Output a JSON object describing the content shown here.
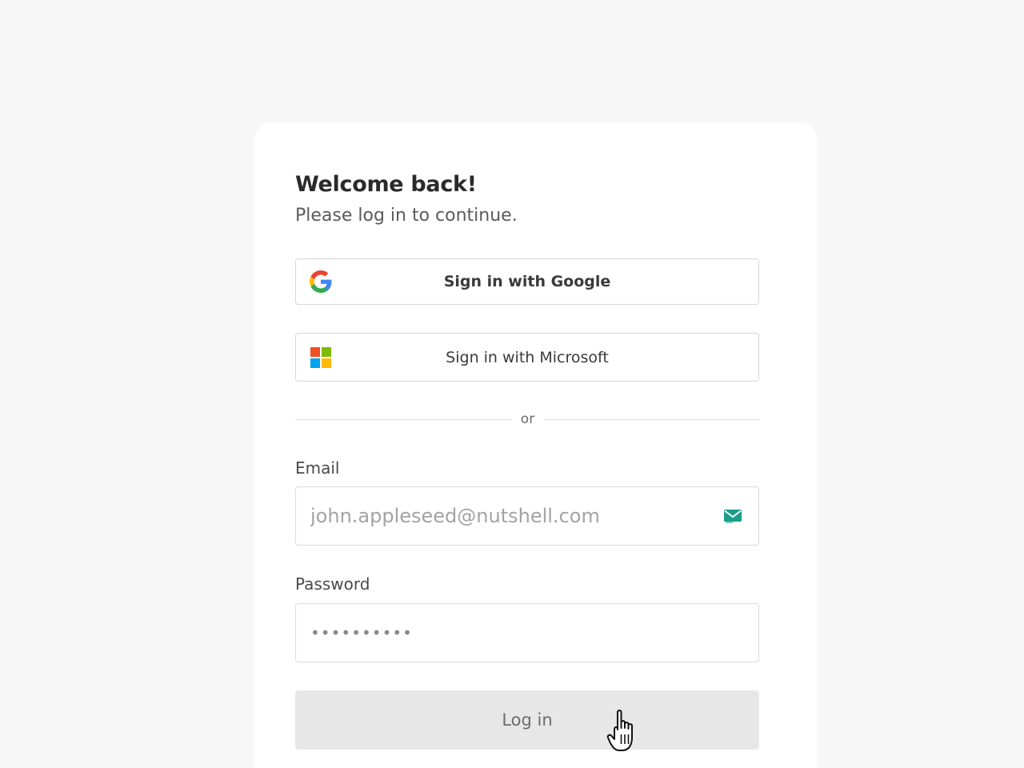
{
  "login": {
    "heading": "Welcome back!",
    "subheading": "Please log in to continue.",
    "google_button_label": "Sign in with Google",
    "microsoft_button_label": "Sign in with Microsoft",
    "divider_text": "or",
    "email_label": "Email",
    "email_placeholder": "john.appleseed@nutshell.com",
    "email_value": "",
    "password_label": "Password",
    "password_value": "••••••••••",
    "login_button_label": "Log in"
  },
  "icons": {
    "google": "google-logo-icon",
    "microsoft": "microsoft-logo-icon",
    "email_extension": "email-extension-icon",
    "cursor": "hand-pointer-cursor"
  },
  "colors": {
    "page_background": "#f7f7f7",
    "card_background": "#ffffff",
    "login_button_background": "#e8e7e7",
    "email_extension_icon": "#1a9d8a"
  }
}
